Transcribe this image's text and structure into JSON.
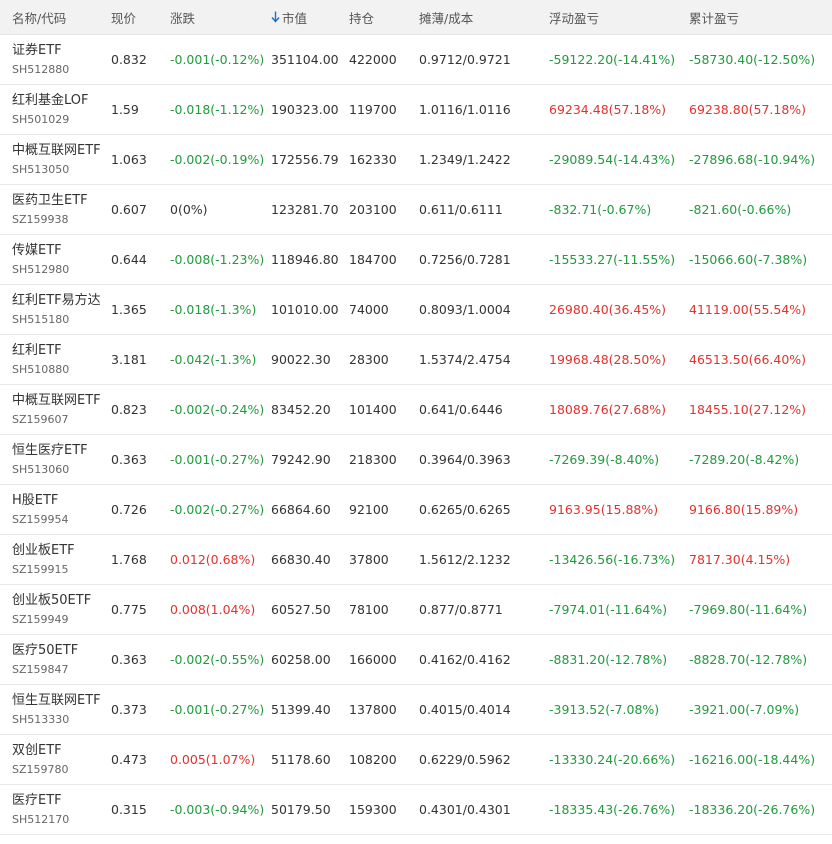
{
  "columns": [
    {
      "key": "name",
      "label": "名称/代码"
    },
    {
      "key": "price",
      "label": "现价"
    },
    {
      "key": "change",
      "label": "涨跌"
    },
    {
      "key": "market_value",
      "label": "市值",
      "sort_icon": "arrow-down-icon",
      "sort_color": "#1a6fd0"
    },
    {
      "key": "position",
      "label": "持仓"
    },
    {
      "key": "cost",
      "label": "摊薄/成本"
    },
    {
      "key": "floating_pnl",
      "label": "浮动盈亏"
    },
    {
      "key": "total_pnl",
      "label": "累计盈亏"
    }
  ],
  "colors": {
    "up": "#e2322d",
    "down": "#1f9b3d",
    "neutral": "#333333",
    "header_bg": "#f2f2f2"
  },
  "rows": [
    {
      "name": "证券ETF",
      "code": "SH512880",
      "price": "0.832",
      "change": "-0.001(-0.12%)",
      "market_value": "351104.00",
      "position": "422000",
      "cost": "0.9712/0.9721",
      "floating_pnl": "-59122.20(-14.41%)",
      "total_pnl": "-58730.40(-12.50%)"
    },
    {
      "name": "红利基金LOF",
      "code": "SH501029",
      "price": "1.59",
      "change": "-0.018(-1.12%)",
      "market_value": "190323.00",
      "position": "119700",
      "cost": "1.0116/1.0116",
      "floating_pnl": "69234.48(57.18%)",
      "total_pnl": "69238.80(57.18%)"
    },
    {
      "name": "中概互联网ETF",
      "code": "SH513050",
      "price": "1.063",
      "change": "-0.002(-0.19%)",
      "market_value": "172556.79",
      "position": "162330",
      "cost": "1.2349/1.2422",
      "floating_pnl": "-29089.54(-14.43%)",
      "total_pnl": "-27896.68(-10.94%)"
    },
    {
      "name": "医药卫生ETF",
      "code": "SZ159938",
      "price": "0.607",
      "change": "0(0%)",
      "market_value": "123281.70",
      "position": "203100",
      "cost": "0.611/0.6111",
      "floating_pnl": "-832.71(-0.67%)",
      "total_pnl": "-821.60(-0.66%)"
    },
    {
      "name": "传媒ETF",
      "code": "SH512980",
      "price": "0.644",
      "change": "-0.008(-1.23%)",
      "market_value": "118946.80",
      "position": "184700",
      "cost": "0.7256/0.7281",
      "floating_pnl": "-15533.27(-11.55%)",
      "total_pnl": "-15066.60(-7.38%)"
    },
    {
      "name": "红利ETF易方达",
      "code": "SH515180",
      "price": "1.365",
      "change": "-0.018(-1.3%)",
      "market_value": "101010.00",
      "position": "74000",
      "cost": "0.8093/1.0004",
      "floating_pnl": "26980.40(36.45%)",
      "total_pnl": "41119.00(55.54%)"
    },
    {
      "name": "红利ETF",
      "code": "SH510880",
      "price": "3.181",
      "change": "-0.042(-1.3%)",
      "market_value": "90022.30",
      "position": "28300",
      "cost": "1.5374/2.4754",
      "floating_pnl": "19968.48(28.50%)",
      "total_pnl": "46513.50(66.40%)"
    },
    {
      "name": "中概互联网ETF",
      "code": "SZ159607",
      "price": "0.823",
      "change": "-0.002(-0.24%)",
      "market_value": "83452.20",
      "position": "101400",
      "cost": "0.641/0.6446",
      "floating_pnl": "18089.76(27.68%)",
      "total_pnl": "18455.10(27.12%)"
    },
    {
      "name": "恒生医疗ETF",
      "code": "SH513060",
      "price": "0.363",
      "change": "-0.001(-0.27%)",
      "market_value": "79242.90",
      "position": "218300",
      "cost": "0.3964/0.3963",
      "floating_pnl": "-7269.39(-8.40%)",
      "total_pnl": "-7289.20(-8.42%)"
    },
    {
      "name": "H股ETF",
      "code": "SZ159954",
      "price": "0.726",
      "change": "-0.002(-0.27%)",
      "market_value": "66864.60",
      "position": "92100",
      "cost": "0.6265/0.6265",
      "floating_pnl": "9163.95(15.88%)",
      "total_pnl": "9166.80(15.89%)"
    },
    {
      "name": "创业板ETF",
      "code": "SZ159915",
      "price": "1.768",
      "change": "0.012(0.68%)",
      "market_value": "66830.40",
      "position": "37800",
      "cost": "1.5612/2.1232",
      "floating_pnl": "-13426.56(-16.73%)",
      "total_pnl": "7817.30(4.15%)"
    },
    {
      "name": "创业板50ETF",
      "code": "SZ159949",
      "price": "0.775",
      "change": "0.008(1.04%)",
      "market_value": "60527.50",
      "position": "78100",
      "cost": "0.877/0.8771",
      "floating_pnl": "-7974.01(-11.64%)",
      "total_pnl": "-7969.80(-11.64%)"
    },
    {
      "name": "医疗50ETF",
      "code": "SZ159847",
      "price": "0.363",
      "change": "-0.002(-0.55%)",
      "market_value": "60258.00",
      "position": "166000",
      "cost": "0.4162/0.4162",
      "floating_pnl": "-8831.20(-12.78%)",
      "total_pnl": "-8828.70(-12.78%)"
    },
    {
      "name": "恒生互联网ETF",
      "code": "SH513330",
      "price": "0.373",
      "change": "-0.001(-0.27%)",
      "market_value": "51399.40",
      "position": "137800",
      "cost": "0.4015/0.4014",
      "floating_pnl": "-3913.52(-7.08%)",
      "total_pnl": "-3921.00(-7.09%)"
    },
    {
      "name": "双创ETF",
      "code": "SZ159780",
      "price": "0.473",
      "change": "0.005(1.07%)",
      "market_value": "51178.60",
      "position": "108200",
      "cost": "0.6229/0.5962",
      "floating_pnl": "-13330.24(-20.66%)",
      "total_pnl": "-16216.00(-18.44%)"
    },
    {
      "name": "医疗ETF",
      "code": "SH512170",
      "price": "0.315",
      "change": "-0.003(-0.94%)",
      "market_value": "50179.50",
      "position": "159300",
      "cost": "0.4301/0.4301",
      "floating_pnl": "-18335.43(-26.76%)",
      "total_pnl": "-18336.20(-26.76%)"
    }
  ]
}
